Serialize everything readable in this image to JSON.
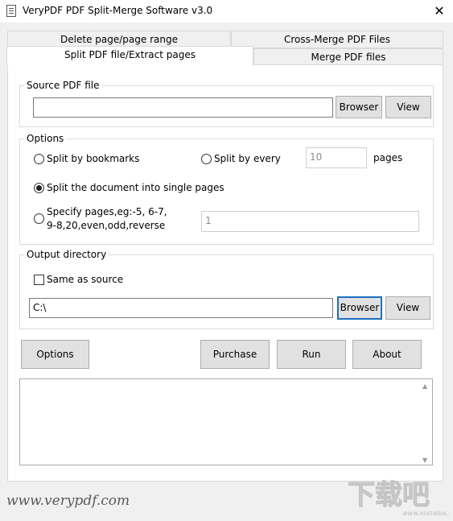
{
  "window": {
    "title": "VeryPDF PDF Split-Merge Software v3.0",
    "close": "✕"
  },
  "tabs": {
    "row1": [
      "Delete page/page range",
      "Cross-Merge PDF Files"
    ],
    "row2": [
      "Split PDF file/Extract pages",
      "Merge PDF files"
    ],
    "active": "Split PDF file/Extract pages"
  },
  "source": {
    "legend": "Source PDF file",
    "value": "",
    "browser": "Browser",
    "view": "View"
  },
  "options": {
    "legend": "Options",
    "split_bookmarks": "Split by bookmarks",
    "split_every": "Split by every",
    "every_value": "10",
    "pages_unit": "pages",
    "single_pages": "Split the document into single pages",
    "specify_line1": "Specify pages,eg:-5, 6-7,",
    "specify_line2": "9-8,20,even,odd,reverse",
    "specify_value": "1",
    "selected": "single_pages"
  },
  "output": {
    "legend": "Output directory",
    "same_as_source": "Same as source",
    "same_checked": false,
    "path": "C:\\",
    "browser": "Browser",
    "view": "View"
  },
  "actions": {
    "options": "Options",
    "purchase": "Purchase",
    "run": "Run",
    "about": "About"
  },
  "log": {
    "text": "",
    "scroll_up": "▲",
    "scroll_down": "▼"
  },
  "watermark": {
    "text": "www.verypdf.com",
    "logo_text": "下载吧",
    "logo_sub": "www.xiazaiba.com"
  },
  "colors": {
    "focus_border": "#1e6fbf",
    "button_bg": "#e1e1e1"
  }
}
